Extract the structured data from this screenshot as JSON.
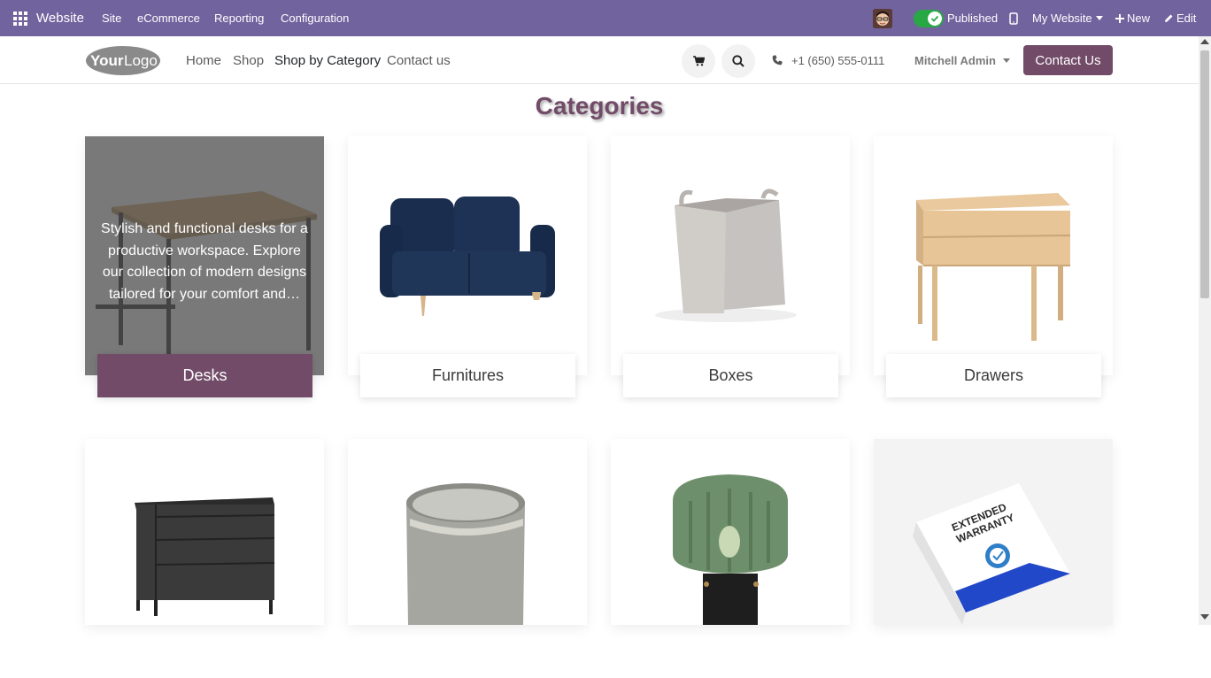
{
  "topbar": {
    "app_name": "Website",
    "menus": [
      "Site",
      "eCommerce",
      "Reporting",
      "Configuration"
    ],
    "published_label": "Published",
    "published_on": true,
    "my_website_label": "My Website",
    "new_label": "New",
    "edit_label": "Edit",
    "bar_color": "#71639e"
  },
  "header": {
    "logo_text_1": "Your",
    "logo_text_2": "Logo",
    "nav": [
      "Home",
      "Shop",
      "Shop by Category",
      "Contact us"
    ],
    "active_nav": "Shop by Category",
    "phone": "+1 (650) 555-0111",
    "user": "Mitchell Admin",
    "contact_button": "Contact Us",
    "accent_color": "#714b67"
  },
  "page": {
    "title": "Categories"
  },
  "categories": [
    {
      "name": "Desks",
      "icon": "desk-image",
      "hovered": true,
      "description": "Stylish and functional desks for a productive workspace. Explore our collection of modern designs tailored for your comfort and…"
    },
    {
      "name": "Furnitures",
      "icon": "sofa-image"
    },
    {
      "name": "Boxes",
      "icon": "basket-image"
    },
    {
      "name": "Drawers",
      "icon": "drawer-cabinet-image"
    },
    {
      "name": "",
      "icon": "dresser-image"
    },
    {
      "name": "",
      "icon": "bin-image"
    },
    {
      "name": "",
      "icon": "lamp-image"
    },
    {
      "name": "",
      "icon": "warranty-box-image",
      "box_text_1": "EXTENDED",
      "box_text_2": "WARRANTY"
    }
  ]
}
